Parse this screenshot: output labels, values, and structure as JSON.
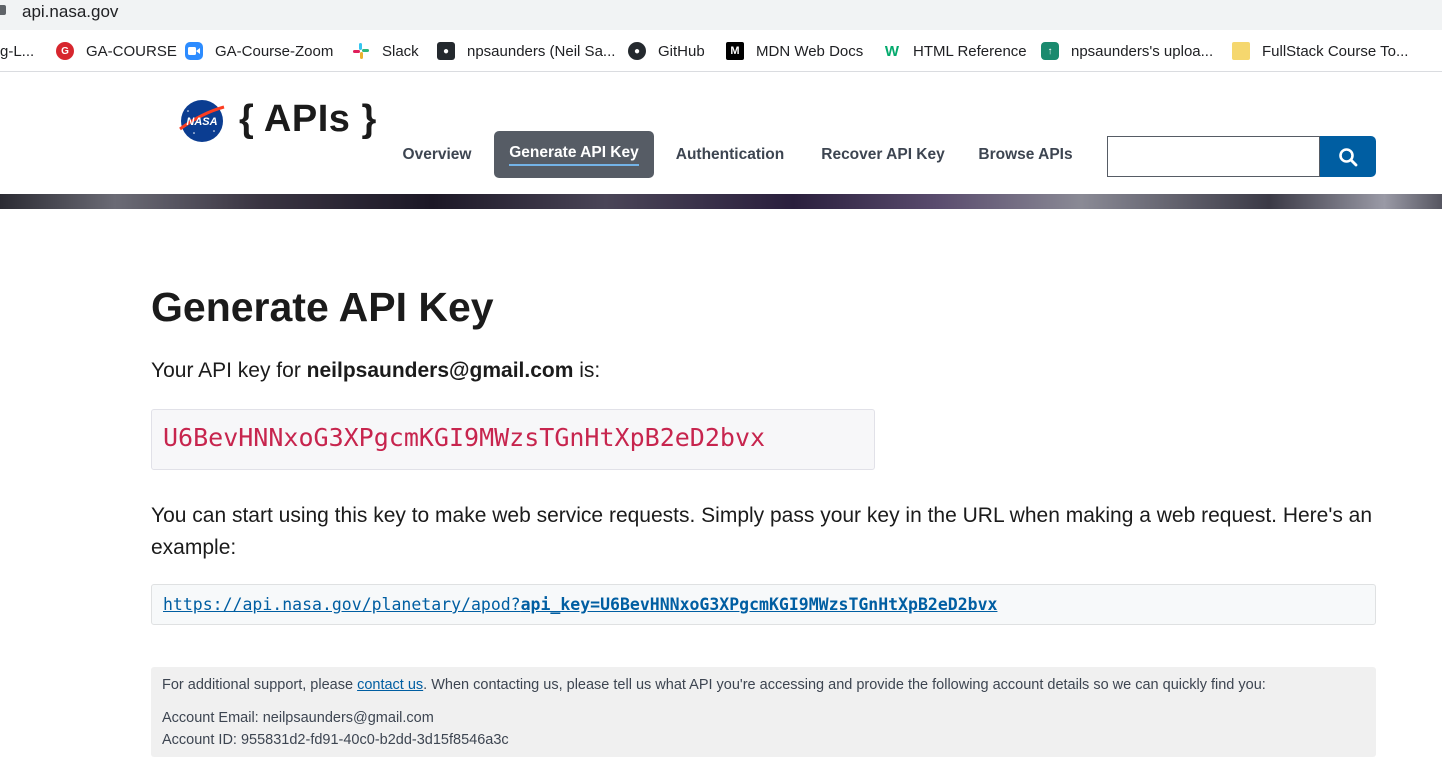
{
  "browser": {
    "url": "api.nasa.gov",
    "bookmarks": [
      {
        "label": "g-L...",
        "icon": "none"
      },
      {
        "label": "GA-COURSE",
        "icon": "ga-icon"
      },
      {
        "label": "GA-Course-Zoom",
        "icon": "zoom-icon"
      },
      {
        "label": "Slack",
        "icon": "slack-icon"
      },
      {
        "label": "npsaunders (Neil Sa...",
        "icon": "github-icon"
      },
      {
        "label": "GitHub",
        "icon": "github-icon"
      },
      {
        "label": "MDN Web Docs",
        "icon": "mdn-icon"
      },
      {
        "label": "HTML Reference",
        "icon": "w3schools-icon"
      },
      {
        "label": "npsaunders's uploa...",
        "icon": "upload-icon"
      },
      {
        "label": "FullStack Course To...",
        "icon": "folder-icon"
      }
    ]
  },
  "header": {
    "brand": "{ APIs }",
    "nav": [
      "Overview",
      "Generate API Key",
      "Authentication",
      "Recover API Key",
      "Browse APIs"
    ],
    "active_nav": "Generate API Key",
    "search_placeholder": ""
  },
  "main": {
    "title": "Generate API Key",
    "intro_prefix": "Your API key for ",
    "email": "neilpsaunders@gmail.com",
    "intro_suffix": " is:",
    "api_key": "U6BevHNNxoG3XPgcmKGI9MWzsTGnHtXpB2eD2bvx",
    "usage_text": "You can start using this key to make web service requests. Simply pass your key in the URL when making a web request. Here's an example:",
    "example_url_base": "https://api.nasa.gov/planetary/apod?",
    "example_url_param": "api_key=U6BevHNNxoG3XPgcmKGI9MWzsTGnHtXpB2eD2bvx"
  },
  "support": {
    "prefix": "For additional support, please ",
    "link": "contact us",
    "suffix": ". When contacting us, please tell us what API you're accessing and provide the following account details so we can quickly find you:",
    "account_email": "Account Email: neilpsaunders@gmail.com",
    "account_id": "Account ID: 955831d2-fd91-40c0-b2dd-3d15f8546a3c"
  },
  "colors": {
    "accent": "#005ea2",
    "nav_active_bg": "#565c65",
    "key_color": "#c7254e"
  }
}
